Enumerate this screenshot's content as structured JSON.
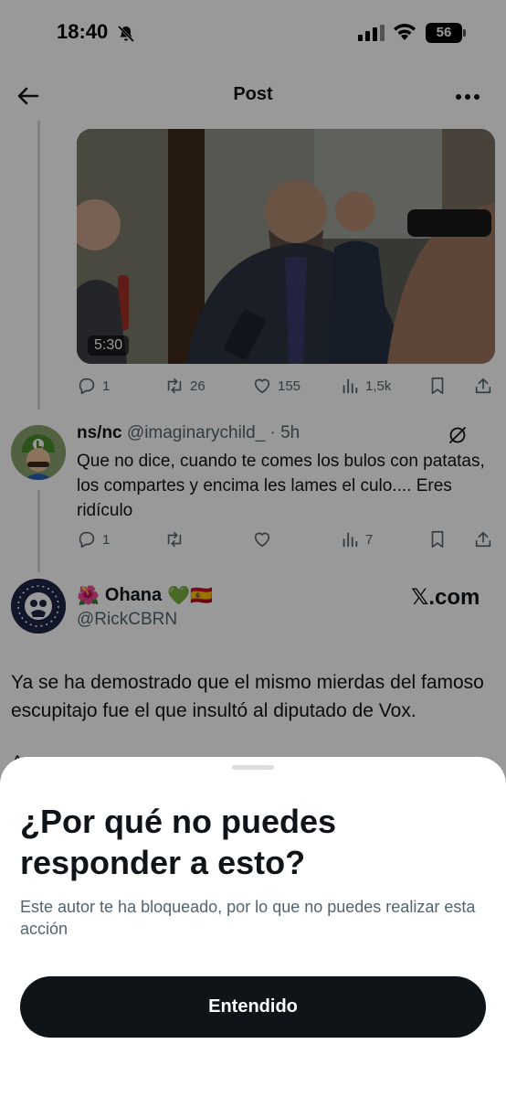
{
  "status_bar": {
    "time": "18:40",
    "battery": "56",
    "icons": [
      "bell-slash-icon",
      "cellular-signal-icon",
      "wifi-icon",
      "battery-icon"
    ]
  },
  "nav": {
    "title": "Post",
    "back_icon": "arrow-left-icon",
    "more_icon": "more-horizontal-icon"
  },
  "video_post": {
    "duration": "5:30",
    "actions": {
      "replies": "1",
      "reposts": "26",
      "likes": "155",
      "views": "1,5k"
    }
  },
  "reply": {
    "name": "ns/nc",
    "handle_time": "@imaginarychild_ · 5h",
    "text": "Que no dice, cuando te comes los bulos con patatas, los compartes y encima les lames el culo.... Eres ridículo",
    "actions": {
      "replies": "1",
      "views": "7"
    }
  },
  "embedded_post": {
    "name": "Ohana",
    "name_emoji_prefix": "🌺",
    "name_emoji_suffix": "💚🇪🇸",
    "handle": "@RickCBRN",
    "source": "𝕏.com",
    "text": "Ya se ha demostrado que el mismo mierdas del famoso escupitajo fue el que insultó al diputado de Vox.",
    "text_cut": "A..."
  },
  "sheet": {
    "title": "¿Por qué no puedes responder a esto?",
    "description": "Este autor te ha bloqueado, por lo que no puedes realizar esta acción",
    "button_label": "Entendido"
  },
  "colors": {
    "text_primary": "#0f1419",
    "text_secondary": "#536471",
    "button_bg": "#0f1419",
    "overlay": "rgba(0,0,0,0.40)"
  }
}
